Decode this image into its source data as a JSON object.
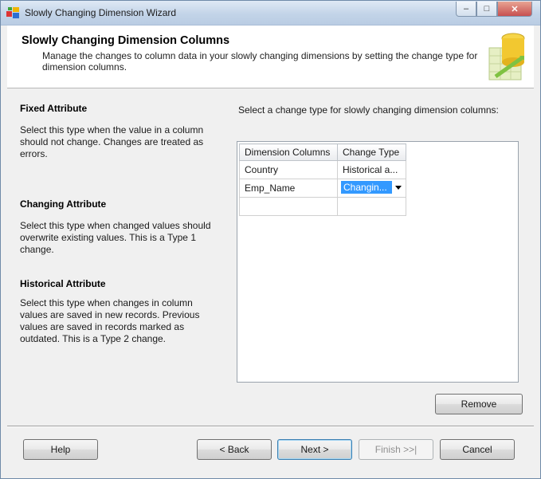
{
  "window": {
    "title": "Slowly Changing Dimension Wizard",
    "caption": {
      "minimize": "‒",
      "maximize": "□",
      "close": "✕"
    }
  },
  "header": {
    "title": "Slowly Changing Dimension Columns",
    "description": "Manage the changes to column data in your slowly changing dimensions by setting the change type for dimension columns."
  },
  "sections": [
    {
      "title": "Fixed Attribute",
      "text": "Select this type when the value in a column should not change. Changes are treated as errors."
    },
    {
      "title": "Changing Attribute",
      "text": "Select this type when changed values should overwrite existing values. This is a Type 1 change."
    },
    {
      "title": "Historical Attribute",
      "text": "Select this type when changes in column values are saved in new records. Previous values are saved in records marked as outdated. This is a Type 2 change."
    }
  ],
  "instruction": "Select a change type for slowly changing dimension columns:",
  "grid": {
    "headers": [
      "Dimension Columns",
      "Change Type"
    ],
    "rows": [
      {
        "column": "Country",
        "type": "Historical a..."
      },
      {
        "column": "Emp_Name",
        "type": "Changin..."
      }
    ]
  },
  "buttons": {
    "remove": "Remove",
    "help": "Help",
    "back": "< Back",
    "next": "Next >",
    "finish": "Finish >>|",
    "cancel": "Cancel"
  }
}
